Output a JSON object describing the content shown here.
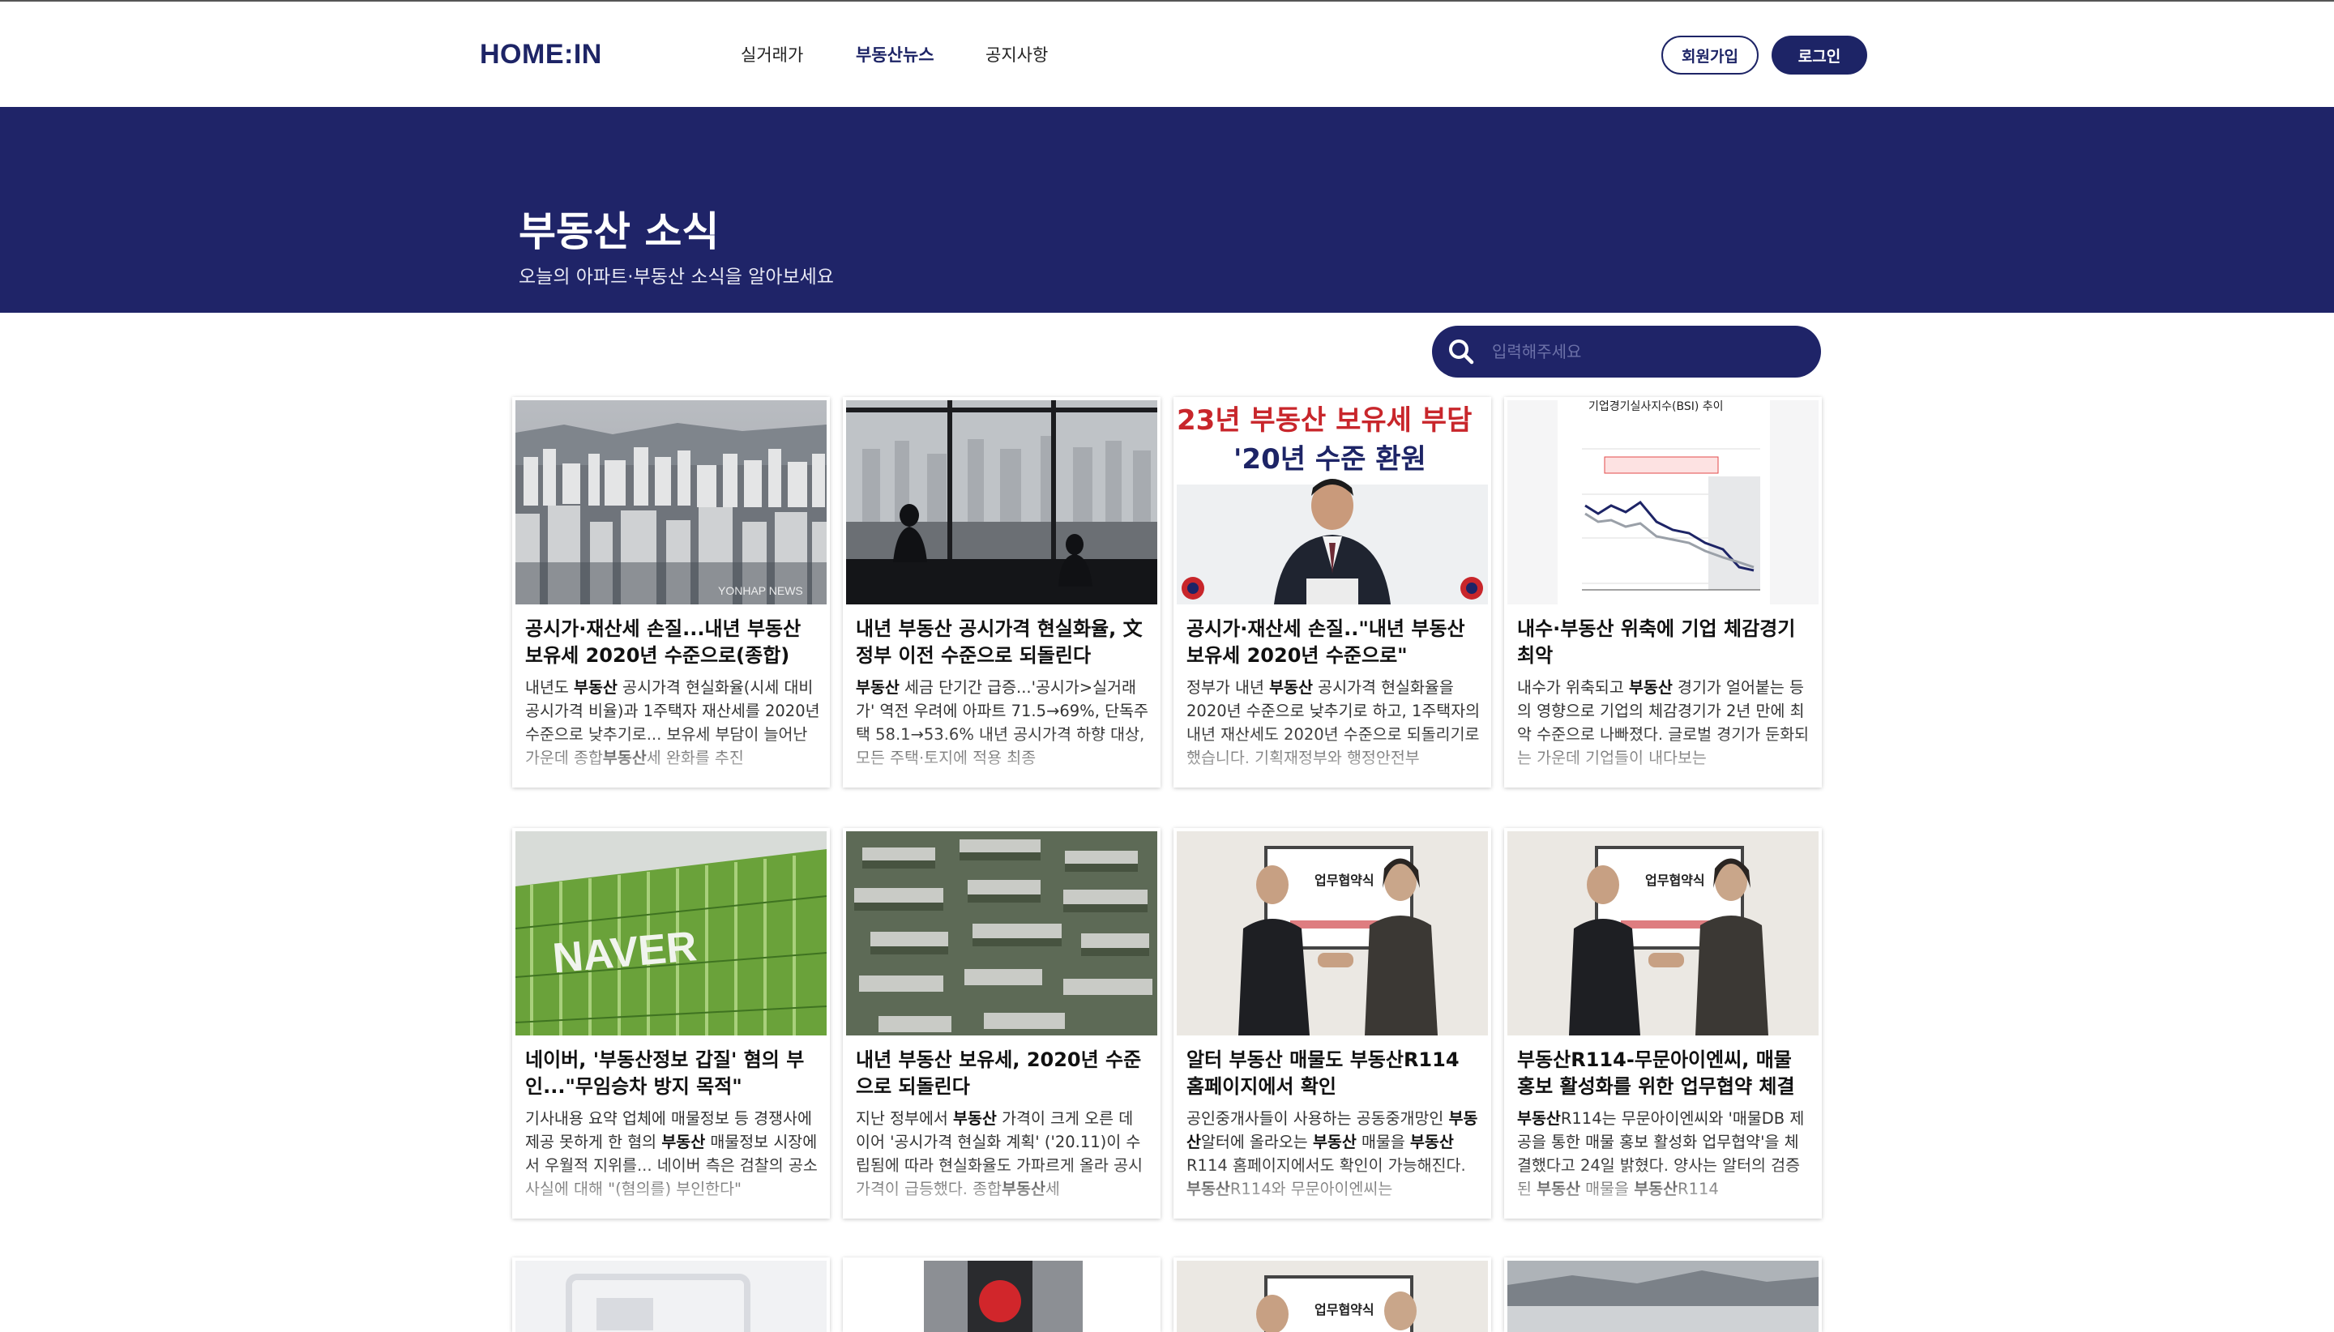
{
  "header": {
    "logo": "HOME:IN",
    "nav": [
      "실거래가",
      "부동산뉴스",
      "공지사항"
    ],
    "active_nav": "부동산뉴스",
    "signup": "회원가입",
    "login": "로그인"
  },
  "hero": {
    "title": "부동산 소식",
    "subtitle": "오늘의 아파트·부동산 소식을 알아보세요"
  },
  "search": {
    "placeholder": "입력해주세요"
  },
  "colors": {
    "brand": "#1f2468"
  },
  "cards": [
    {
      "title": "공시가·재산세 손질...내년 부동산 보유세 2020년 수준으로(종합)",
      "desc": "내년도 <b>부동산</b> 공시가격 현실화율(시세 대비 공시가격 비율)과 1주택자 재산세를 2020년 수준으로 낮추기로... 보유세 부담이 늘어난 가운데 종합<b>부동산</b>세 완화를 추진",
      "image_text": "YONHAP NEWS"
    },
    {
      "title": "내년 부동산 공시가격 현실화율, 文 정부 이전 수준으로 되돌린다",
      "desc": "<b>부동산</b> 세금 단기간 급증...'공시가>실거래가' 역전 우려에 아파트 71.5→69%, 단독주택 58.1→53.6% 내년 공시가격 하향 대상, 모든 주택·토지에 적용 최종",
      "image_text": ""
    },
    {
      "title": "공시가·재산세 손질..\"내년 부동산 보유세 2020년 수준으로\"",
      "desc": "정부가 내년 <b>부동산</b> 공시가격 현실화율을 2020년 수준으로 낮추기로 하고, 1주택자의 내년 재산세도 2020년 수준으로 되돌리기로 했습니다. 기획재정부와 행정안전부",
      "image_text": "23년 부동산 보유세 부담 '20년 수준 환원"
    },
    {
      "title": "내수·부동산 위축에 기업 체감경기 최악",
      "desc": "내수가 위축되고 <b>부동산</b> 경기가 얼어붙는 등의 영향으로 기업의 체감경기가 2년 만에 최악 수준으로 나빠졌다. 글로벌 경기가 둔화되는 가운데 기업들이 내다보는",
      "image_text": "기업경기실사지수(BSI) 추이"
    },
    {
      "title": "네이버, '부동산정보 갑질' 혐의 부인...\"무임승차 방지 목적\"",
      "desc": "기사내용 요약 업체에 매물정보 등 경쟁사에 제공 못하게 한 혐의 <b>부동산</b> 매물정보 시장에서 우월적 지위를... 네이버 측은 검찰의 공소사실에 대해 \"(혐의를) 부인한다\"",
      "image_text": "NAVER"
    },
    {
      "title": "내년 부동산 보유세, 2020년 수준으로 되돌린다",
      "desc": "지난 정부에서 <b>부동산</b> 가격이 크게 오른 데 이어 '공시가격 현실화 계획' ('20.11)이 수립됨에 따라 현실화율도 가파르게 올라 공시가격이 급등했다. 종합<b>부동산</b>세",
      "image_text": ""
    },
    {
      "title": "알터 부동산 매물도 부동산R114 홈페이지에서 확인",
      "desc": "공인중개사들이 사용하는 공동중개망인 <b>부동산</b>알터에 올라오는 <b>부동산</b> 매물을 <b>부동산</b>R114 홈페이지에서도 확인이 가능해진다. <b>부동산</b>R114와 무문아이엔씨는",
      "image_text": "업무협약식"
    },
    {
      "title": "부동산R114-무문아이엔씨, 매물 홍보 활성화를 위한 업무협약 체결",
      "desc": "<b>부동산</b>R114는 무문아이엔씨와 '매물DB 제공을 통한 매물 홍보 활성화 업무협약'을 체결했다고 24일 밝혔다. 양사는 알터의 검증된 <b>부동산</b> 매물을 <b>부동산</b>R114",
      "image_text": "업무협약식"
    }
  ]
}
